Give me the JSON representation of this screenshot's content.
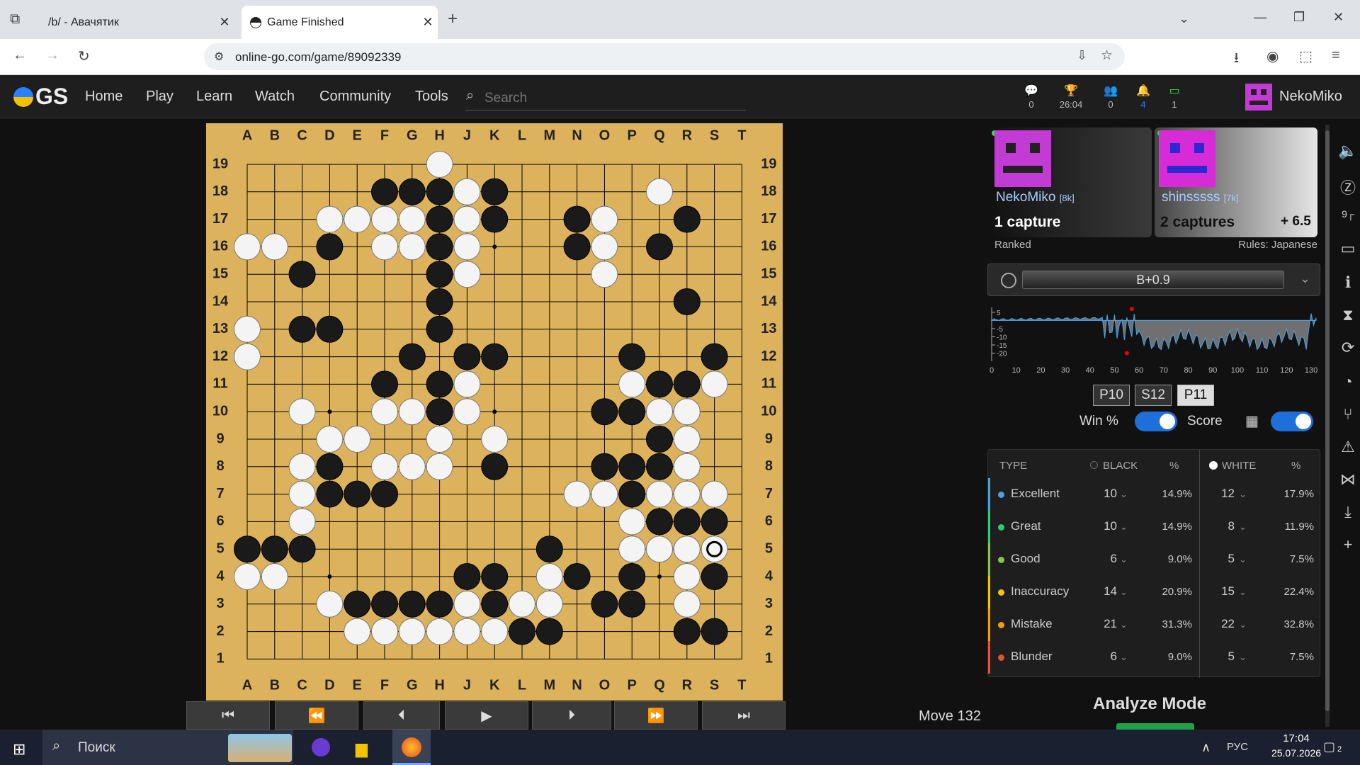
{
  "browser": {
    "tabs": [
      {
        "title": "/b/ - Авачятик"
      },
      {
        "title": "Game Finished"
      }
    ],
    "url": "online-go.com/game/89092339"
  },
  "header": {
    "logo": "GS",
    "menu": [
      "Home",
      "Play",
      "Learn",
      "Watch",
      "Community",
      "Tools"
    ],
    "search_placeholder": "Search",
    "indicators": [
      {
        "icon": "chat-icon",
        "value": "0"
      },
      {
        "icon": "trophy-icon",
        "value": "26:04"
      },
      {
        "icon": "friends-icon",
        "value": "0"
      },
      {
        "icon": "bell-icon",
        "value": "4"
      },
      {
        "icon": "monitor-icon",
        "value": "1"
      }
    ],
    "username": "NekoMiko"
  },
  "board": {
    "cols": [
      "A",
      "B",
      "C",
      "D",
      "E",
      "F",
      "G",
      "H",
      "J",
      "K",
      "L",
      "M",
      "N",
      "O",
      "P",
      "Q",
      "R",
      "S",
      "T"
    ],
    "rows": [
      "19",
      "18",
      "17",
      "16",
      "15",
      "14",
      "13",
      "12",
      "11",
      "10",
      "9",
      "8",
      "7",
      "6",
      "5",
      "4",
      "3",
      "2",
      "1"
    ],
    "black": [
      "F18",
      "G18",
      "H18",
      "K18",
      "H17",
      "K17",
      "N17",
      "R17",
      "D16",
      "H16",
      "N16",
      "Q16",
      "C15",
      "H15",
      "H14",
      "R14",
      "C13",
      "D13",
      "H13",
      "G12",
      "J12",
      "K12",
      "P12",
      "S12",
      "F11",
      "H11",
      "Q11",
      "R11",
      "H10",
      "O10",
      "P10",
      "D8",
      "K8",
      "O8",
      "P8",
      "Q8",
      "Q9",
      "D7",
      "E7",
      "F7",
      "P7",
      "Q6",
      "R6",
      "S6",
      "A5",
      "B5",
      "C5",
      "M5",
      "P4",
      "N4",
      "J4",
      "K4",
      "S4",
      "E3",
      "F3",
      "G3",
      "H3",
      "K3",
      "O3",
      "P3",
      "L2",
      "M2",
      "R2",
      "S2"
    ],
    "white": [
      "H19",
      "Q18",
      "J18",
      "D17",
      "E17",
      "F17",
      "G17",
      "J17",
      "O17",
      "A16",
      "B16",
      "F16",
      "G16",
      "J16",
      "O16",
      "J15",
      "O15",
      "A13",
      "A12",
      "J11",
      "P11",
      "S11",
      "C10",
      "F10",
      "G10",
      "J10",
      "Q10",
      "R10",
      "D9",
      "E9",
      "H9",
      "K9",
      "R9",
      "C8",
      "F8",
      "G8",
      "H8",
      "R8",
      "C7",
      "N7",
      "O7",
      "Q7",
      "R7",
      "S7",
      "C6",
      "P6",
      "P5",
      "Q5",
      "R5",
      "S5",
      "A4",
      "B4",
      "M4",
      "R4",
      "D3",
      "J3",
      "L3",
      "M3",
      "R3",
      "E2",
      "F2",
      "G2",
      "H2",
      "J2",
      "K2"
    ],
    "last_move": "S5"
  },
  "controls": {
    "move_label": "Move 132"
  },
  "players": {
    "black": {
      "name": "NekoMiko",
      "rank": "[8k]",
      "captures": "1 capture"
    },
    "white": {
      "name": "shinsssss",
      "rank": "[7k]",
      "captures": "2 captures",
      "komi": "+ 6.5"
    }
  },
  "game_info": {
    "ranked": "Ranked",
    "rules": "Rules: Japanese"
  },
  "score": {
    "estimate": "B+0.9"
  },
  "chart_data": {
    "type": "line",
    "x_ticks": [
      "0",
      "10",
      "20",
      "30",
      "40",
      "50",
      "60",
      "70",
      "80",
      "90",
      "100",
      "110",
      "120",
      "130"
    ],
    "y_ticks": [
      "5",
      "-5",
      "-10",
      "-15",
      "-20"
    ],
    "xlim": [
      0,
      132
    ],
    "ylim": [
      -25,
      8
    ]
  },
  "variation_buttons": [
    "P10",
    "S12",
    "P11"
  ],
  "toggles": {
    "win_label": "Win %",
    "score_label": "Score"
  },
  "stats": {
    "headers": {
      "type": "TYPE",
      "black": "BLACK",
      "pct": "%",
      "white": "WHITE"
    },
    "rows": [
      {
        "type": "Excellent",
        "color": "#4aa3df",
        "b": "10",
        "bp": "14.9%",
        "w": "12",
        "wp": "17.9%"
      },
      {
        "type": "Great",
        "color": "#2ecc71",
        "b": "10",
        "bp": "14.9%",
        "w": "8",
        "wp": "11.9%"
      },
      {
        "type": "Good",
        "color": "#8bc34a",
        "b": "6",
        "bp": "9.0%",
        "w": "5",
        "wp": "7.5%"
      },
      {
        "type": "Inaccuracy",
        "color": "#f1c40f",
        "b": "14",
        "bp": "20.9%",
        "w": "15",
        "wp": "22.4%"
      },
      {
        "type": "Mistake",
        "color": "#f39c12",
        "b": "21",
        "bp": "31.3%",
        "w": "22",
        "wp": "32.8%"
      },
      {
        "type": "Blunder",
        "color": "#e74c3c",
        "b": "6",
        "bp": "9.0%",
        "w": "5",
        "wp": "7.5%"
      }
    ]
  },
  "analyze": {
    "title": "Analyze Mode"
  },
  "taskbar": {
    "search": "Поиск",
    "lang": "РУС",
    "time": "17:04",
    "date": "25.07.2026",
    "notif": "2"
  }
}
